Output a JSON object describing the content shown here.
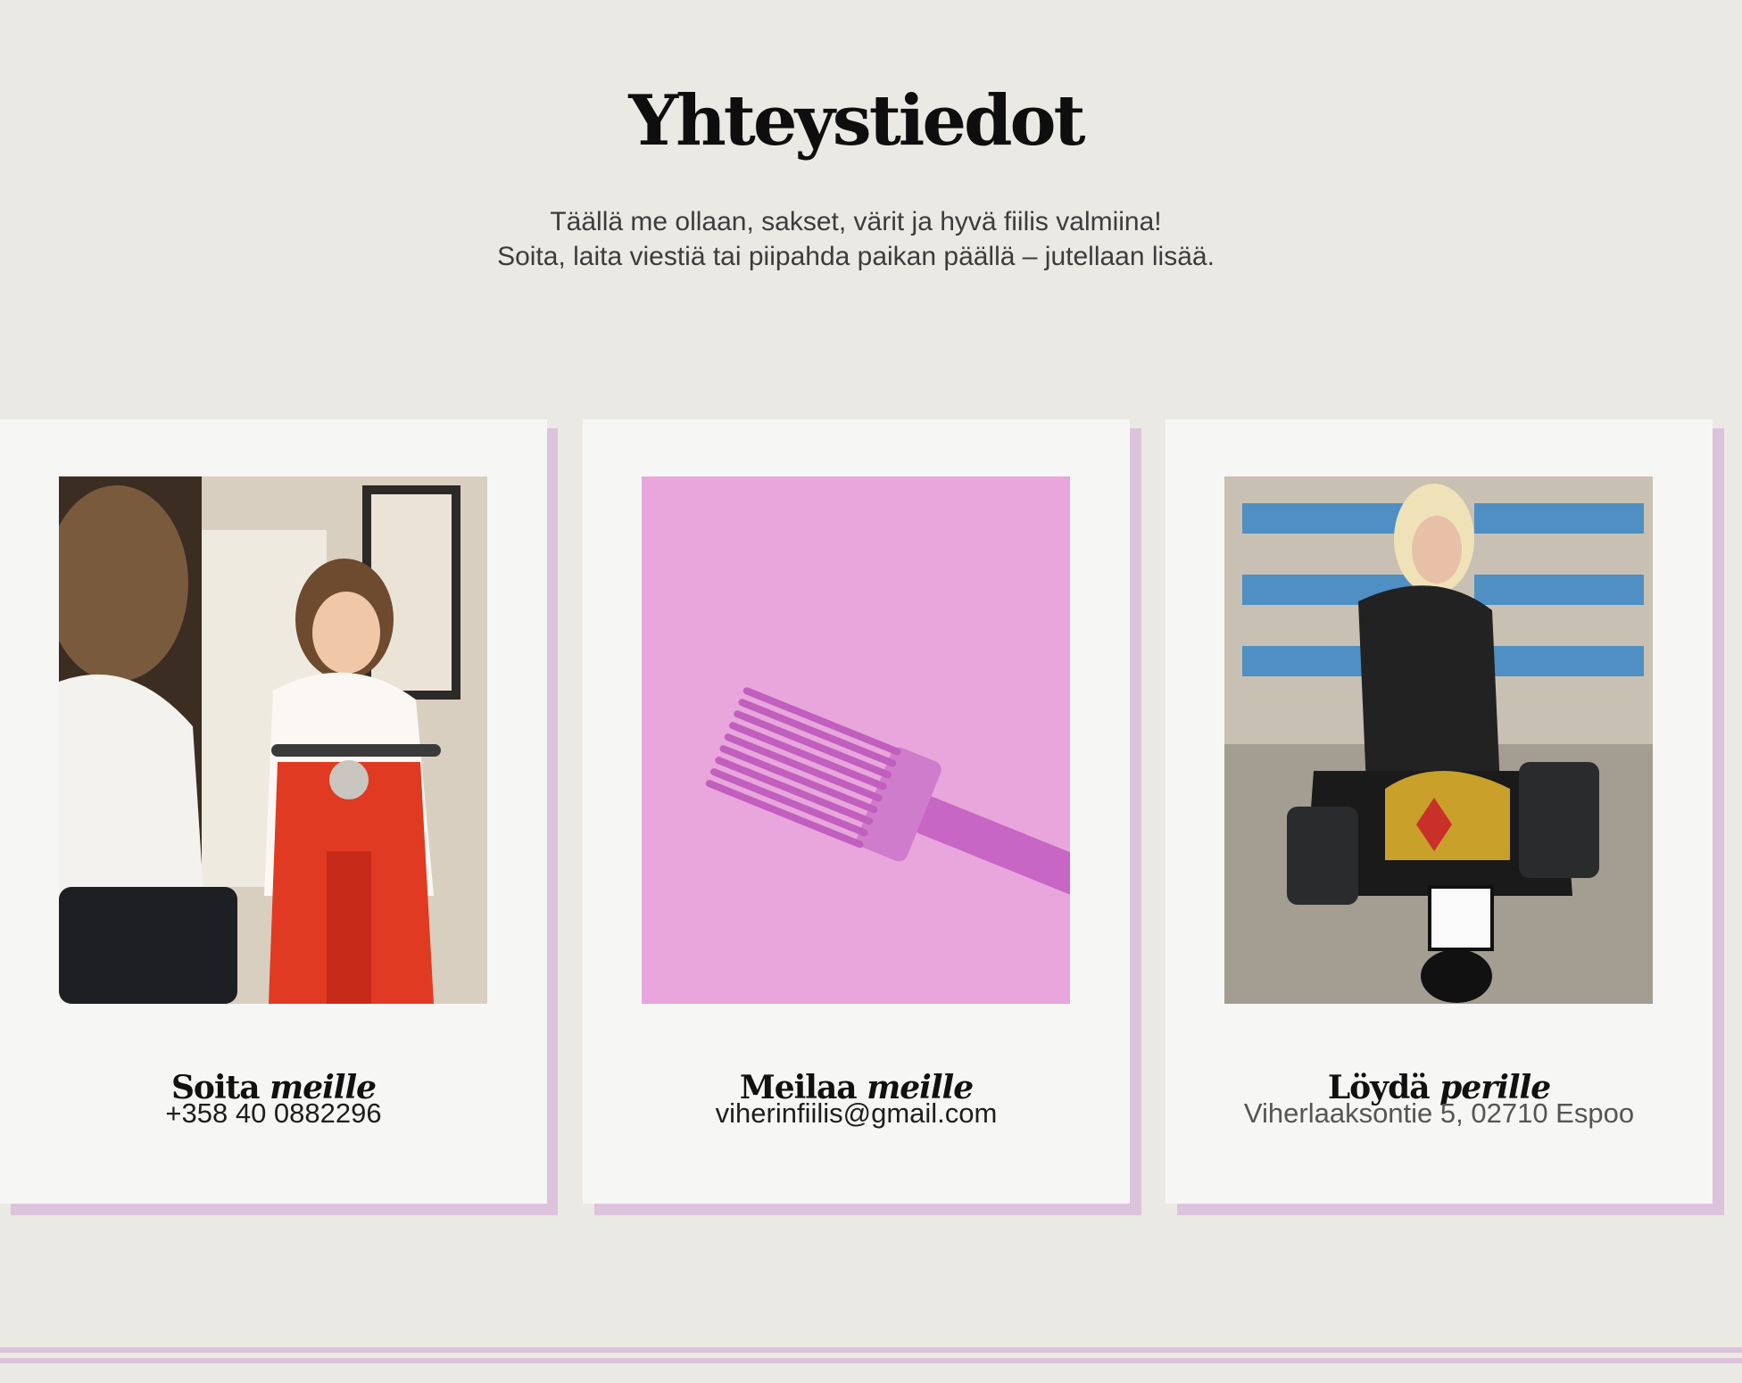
{
  "header": {
    "title": "Yhteystiedot",
    "intro_line1": "Täällä me ollaan, sakset, värit ja hyvä fiilis valmiina!",
    "intro_line2": "Soita, laita viestiä tai piipahda paikan päällä – jutellaan lisää."
  },
  "cards": [
    {
      "heading_regular": "Soita",
      "heading_italic": "meille",
      "info": "+358 40 0882296",
      "image": "child-on-red-scooter-photo"
    },
    {
      "heading_regular": "Meilaa",
      "heading_italic": "meille",
      "info": "viherinfiilis@gmail.com",
      "image": "pink-comb-photo"
    },
    {
      "heading_regular": "Löydä",
      "heading_italic": "perille",
      "info": "Viherlaaksontie 5, 02710 Espoo",
      "image": "woman-on-motorcycle-photo"
    }
  ],
  "colors": {
    "background": "#ebe9e3",
    "card": "#f6f6f5",
    "accent_shadow": "#dcc3dc",
    "comb_background": "#e8a6dc"
  }
}
